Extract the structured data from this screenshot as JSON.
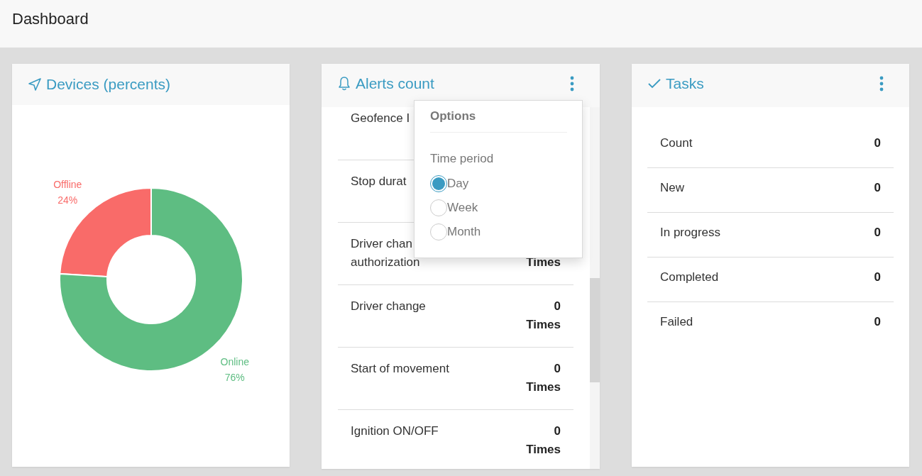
{
  "page": {
    "title": "Dashboard"
  },
  "cards": [
    {
      "kind": "chart",
      "title": "Devices (percents)",
      "menu": false,
      "chart_data": {
        "type": "donut",
        "categories": [
          "Offline",
          "Online"
        ],
        "values": [
          24,
          76
        ],
        "colors": [
          "#f96b69",
          "#5ebd82"
        ],
        "value_labels": [
          "24%",
          "76%"
        ]
      }
    },
    {
      "kind": "alerts",
      "title": "Alerts count",
      "menu": true,
      "rows": [
        {
          "lines": [
            "Geofence I"
          ]
        },
        {
          "lines": [
            "Stop durat"
          ]
        },
        {
          "lines": [
            "Driver chan",
            "authorization"
          ],
          "unit": "Times"
        },
        {
          "lines": [
            "Driver change"
          ],
          "count": "0",
          "unit": "Times"
        },
        {
          "lines": [
            "Start of movement"
          ],
          "count": "0",
          "unit": "Times"
        },
        {
          "lines": [
            "Ignition ON/OFF"
          ],
          "count": "0",
          "unit": "Times"
        }
      ],
      "options_menu": {
        "title": "Options",
        "section": "Time period",
        "choices": [
          {
            "label": "Day",
            "selected": true
          },
          {
            "label": "Week",
            "selected": false
          },
          {
            "label": "Month",
            "selected": false
          }
        ]
      }
    },
    {
      "kind": "tasks",
      "title": "Tasks",
      "menu": true,
      "rows": [
        {
          "label": "Count",
          "value": "0"
        },
        {
          "label": "New",
          "value": "0"
        },
        {
          "label": "In progress",
          "value": "0"
        },
        {
          "label": "Completed",
          "value": "0"
        },
        {
          "label": "Failed",
          "value": "0"
        }
      ]
    }
  ]
}
